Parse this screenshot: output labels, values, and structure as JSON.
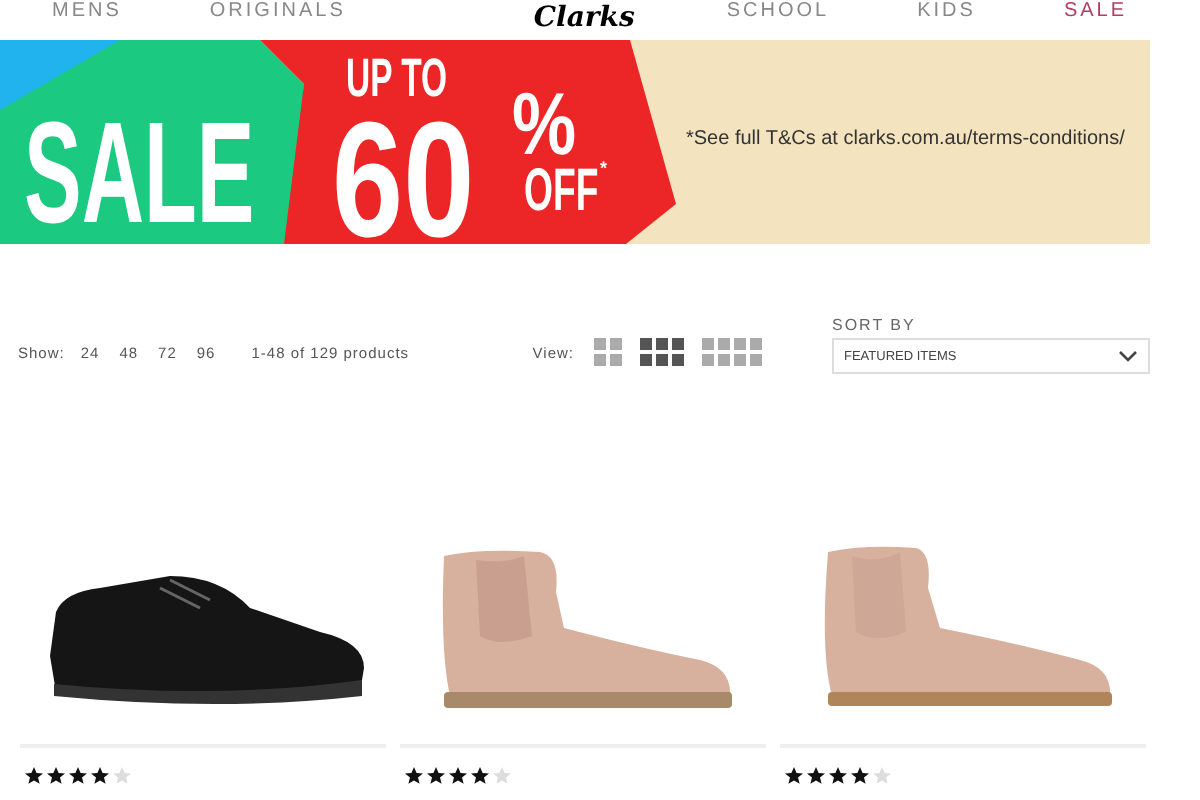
{
  "nav": {
    "items": [
      {
        "label": "MENS",
        "kind": "link"
      },
      {
        "label": "ORIGINALS",
        "kind": "link"
      },
      {
        "label": "Clarks",
        "kind": "logo"
      },
      {
        "label": "SCHOOL",
        "kind": "link"
      },
      {
        "label": "KIDS",
        "kind": "link"
      },
      {
        "label": "SALE",
        "kind": "sale"
      }
    ]
  },
  "banner": {
    "headline": "SALE",
    "up_to": "UP TO",
    "amount": "60",
    "percent": "%",
    "off": "OFF",
    "asterisk": "*",
    "terms": "*See full T&Cs at clarks.com.au/terms-conditions/"
  },
  "toolbar": {
    "show_label": "Show:",
    "show_options": [
      "24",
      "48",
      "72",
      "96"
    ],
    "count": "1-48 of 129 products",
    "view_label": "View:",
    "view_options": [
      {
        "kind": "grid-2",
        "selected": false
      },
      {
        "kind": "grid-3",
        "selected": true
      },
      {
        "kind": "grid-4",
        "selected": false
      }
    ],
    "sort_label": "SORT BY",
    "sort_value": "FEATURED ITEMS"
  },
  "products": [
    {
      "kind": "school-shoe",
      "stars": 4
    },
    {
      "kind": "glitter-boot",
      "stars": 4
    },
    {
      "kind": "plain-boot",
      "stars": 4
    }
  ]
}
